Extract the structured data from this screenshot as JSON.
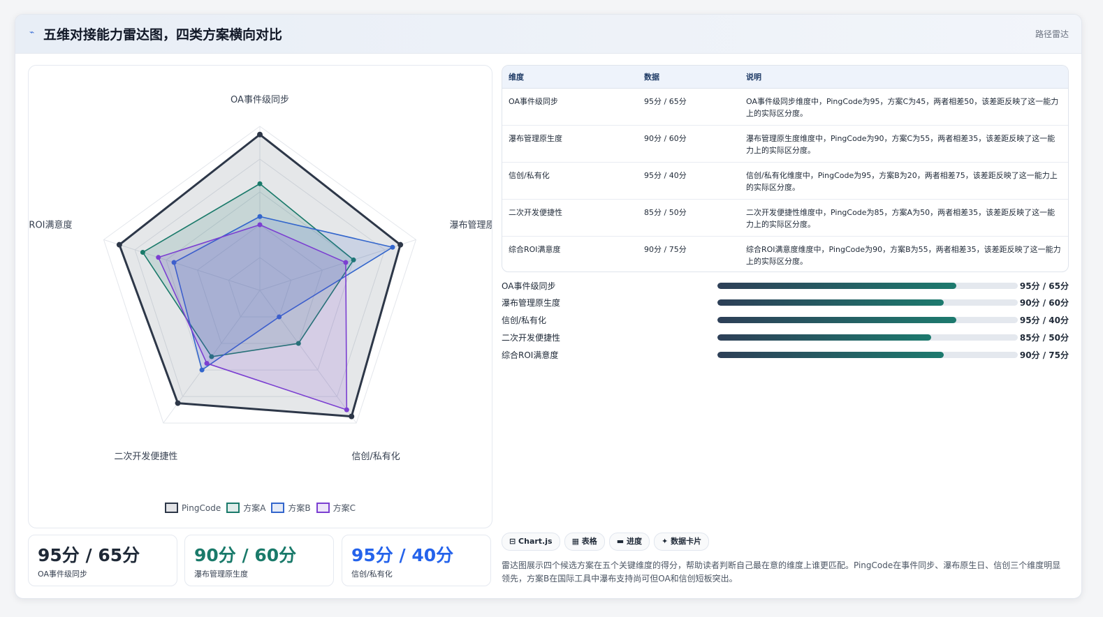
{
  "header": {
    "icon": "chart-line-icon",
    "title": "五维对接能力雷达图，四类方案横向对比",
    "tag": "路径雷达"
  },
  "chart_data": {
    "type": "radar",
    "axes": [
      "OA事件级同步",
      "瀑布管理原生度",
      "信创/私有化",
      "二次开发便捷性",
      "综合ROI满意度"
    ],
    "range": [
      0,
      100
    ],
    "grid_levels": 5,
    "legend_position": "bottom",
    "series": [
      {
        "name": "PingCode",
        "values": [
          95,
          90,
          95,
          85,
          90
        ],
        "color": "#2d3748"
      },
      {
        "name": "方案A",
        "values": [
          65,
          60,
          40,
          50,
          75
        ],
        "color": "#1a7a6a"
      },
      {
        "name": "方案B",
        "values": [
          45,
          85,
          20,
          60,
          55
        ],
        "color": "#3366cc"
      },
      {
        "name": "方案C",
        "values": [
          40,
          55,
          90,
          55,
          65
        ],
        "color": "#7b3fd1"
      }
    ]
  },
  "stats": [
    {
      "value": "95分 / 65分",
      "label": "OA事件级同步",
      "color": "#1f2937"
    },
    {
      "value": "90分 / 60分",
      "label": "瀑布管理原生度",
      "color": "#1a7a6a"
    },
    {
      "value": "95分 / 40分",
      "label": "信创/私有化",
      "color": "#2563eb"
    }
  ],
  "table": {
    "headers": [
      "维度",
      "数据",
      "说明"
    ],
    "rows": [
      {
        "dim": "OA事件级同步",
        "data": "95分 / 65分",
        "note": "OA事件级同步维度中，PingCode为95，方案C为45，两者相差50，该差距反映了这一能力上的实际区分度。"
      },
      {
        "dim": "瀑布管理原生度",
        "data": "90分 / 60分",
        "note": "瀑布管理原生度维度中，PingCode为90，方案C为55，两者相差35，该差距反映了这一能力上的实际区分度。"
      },
      {
        "dim": "信创/私有化",
        "data": "95分 / 40分",
        "note": "信创/私有化维度中，PingCode为95，方案B为20，两者相差75，该差距反映了这一能力上的实际区分度。"
      },
      {
        "dim": "二次开发便捷性",
        "data": "85分 / 50分",
        "note": "二次开发便捷性维度中，PingCode为85，方案A为50，两者相差35，该差距反映了这一能力上的实际区分度。"
      },
      {
        "dim": "综合ROI满意度",
        "data": "90分 / 75分",
        "note": "综合ROI满意度维度中，PingCode为90，方案B为55，两者相差35，该差距反映了这一能力上的实际区分度。"
      }
    ]
  },
  "progress": [
    {
      "label": "OA事件级同步",
      "value": "95分 / 65分",
      "fill": 0.795
    },
    {
      "label": "瀑布管理原生度",
      "value": "90分 / 60分",
      "fill": 0.753
    },
    {
      "label": "信创/私有化",
      "value": "95分 / 40分",
      "fill": 0.795
    },
    {
      "label": "二次开发便捷性",
      "value": "85分 / 50分",
      "fill": 0.712
    },
    {
      "label": "综合ROI满意度",
      "value": "90分 / 75分",
      "fill": 0.753
    }
  ],
  "chips": [
    "⊟ Chart.js",
    "▦ 表格",
    "▬ 进度",
    "✦ 数据卡片"
  ],
  "description": "雷达图展示四个候选方案在五个关键维度的得分，帮助读者判断自己最在意的维度上谁更匹配。PingCode在事件同步、瀑布原生日、信创三个维度明显领先，方案B在国际工具中瀑布支持尚可但OA和信创短板突出。"
}
